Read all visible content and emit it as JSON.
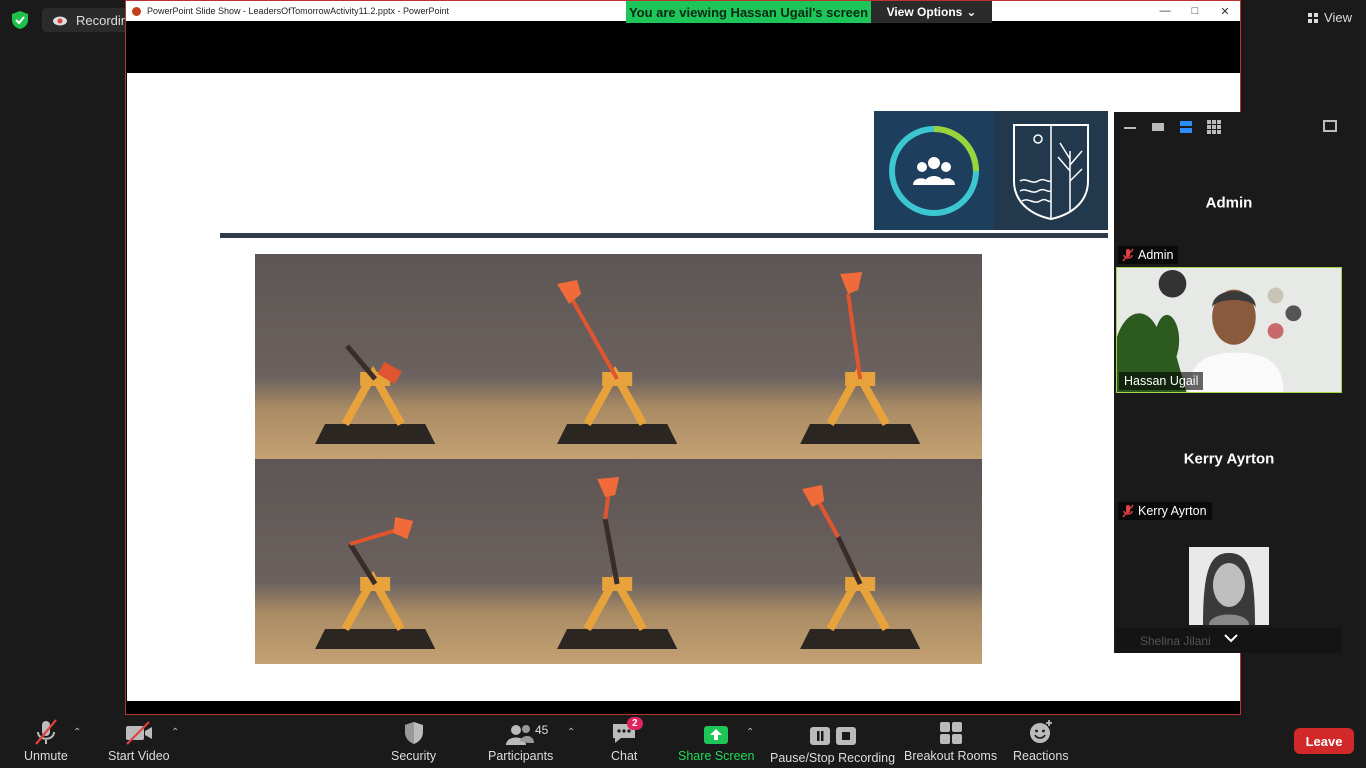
{
  "status": {
    "recording_label": "Recording...",
    "view_label": "View"
  },
  "shared_window": {
    "title": "PowerPoint Slide Show  -  LeadersOfTomorrowActivity11.2.pptx  -  PowerPoint",
    "viewing_banner": "You are viewing Hassan Ugail's screen",
    "view_options_label": "View Options"
  },
  "panel": {
    "tiles": [
      {
        "display_name": "Admin",
        "tag_name": "Admin",
        "video": false
      },
      {
        "display_name": "Hassan Ugail",
        "tag_name": "Hassan Ugail",
        "video": true
      },
      {
        "display_name": "Kerry Ayrton",
        "tag_name": "Kerry Ayrton",
        "video": false
      }
    ],
    "partial_name": "Shelina Jilani"
  },
  "toolbar": {
    "unmute_label": "Unmute",
    "start_video_label": "Start Video",
    "security_label": "Security",
    "participants_label": "Participants",
    "participants_count": "45",
    "chat_label": "Chat",
    "chat_badge": "2",
    "share_screen_label": "Share Screen",
    "pause_stop_recording_label": "Pause/Stop Recording",
    "breakout_rooms_label": "Breakout Rooms",
    "reactions_label": "Reactions",
    "leave_label": "Leave"
  },
  "colors": {
    "share_green": "#1ec65a",
    "leave_red": "#d12929",
    "active_speaker_border": "#a8d44d",
    "muted_red": "#e04040"
  }
}
